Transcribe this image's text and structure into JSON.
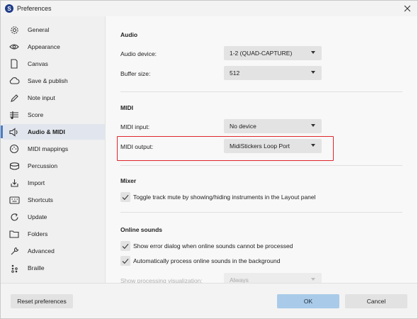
{
  "window": {
    "title": "Preferences",
    "app_icon_letter": "S"
  },
  "sidebar": {
    "items": [
      {
        "label": "General",
        "icon": "gear-icon"
      },
      {
        "label": "Appearance",
        "icon": "eye-icon"
      },
      {
        "label": "Canvas",
        "icon": "page-icon"
      },
      {
        "label": "Save & publish",
        "icon": "cloud-icon"
      },
      {
        "label": "Note input",
        "icon": "pen-icon"
      },
      {
        "label": "Score",
        "icon": "score-icon"
      },
      {
        "label": "Audio & MIDI",
        "icon": "speaker-icon",
        "active": true
      },
      {
        "label": "MIDI mappings",
        "icon": "midi-port-icon"
      },
      {
        "label": "Percussion",
        "icon": "drum-icon"
      },
      {
        "label": "Import",
        "icon": "import-icon"
      },
      {
        "label": "Shortcuts",
        "icon": "keyboard-icon"
      },
      {
        "label": "Update",
        "icon": "refresh-icon"
      },
      {
        "label": "Folders",
        "icon": "folder-icon"
      },
      {
        "label": "Advanced",
        "icon": "wrench-icon"
      },
      {
        "label": "Braille",
        "icon": "braille-icon"
      }
    ]
  },
  "audio": {
    "title": "Audio",
    "device_label": "Audio device:",
    "device_value": "1-2 (QUAD-CAPTURE)",
    "buffer_label": "Buffer size:",
    "buffer_value": "512"
  },
  "midi": {
    "title": "MIDI",
    "input_label": "MIDI input:",
    "input_value": "No device",
    "output_label": "MIDI output:",
    "output_value": "MidiStickers Loop Port"
  },
  "mixer": {
    "title": "Mixer",
    "toggle_mute_label": "Toggle track mute by showing/hiding instruments in the Layout panel",
    "toggle_mute_checked": true
  },
  "online_sounds": {
    "title": "Online sounds",
    "show_error_label": "Show error dialog when online sounds cannot be processed",
    "show_error_checked": true,
    "auto_process_label": "Automatically process online sounds in the background",
    "auto_process_checked": true,
    "visualization_label": "Show processing visualization:",
    "visualization_value": "Always"
  },
  "footer": {
    "reset_label": "Reset preferences",
    "ok_label": "OK",
    "cancel_label": "Cancel"
  },
  "colors": {
    "accent": "#4a7dc4",
    "primary_button": "#a9cbe9",
    "highlight_box": "#e0262b"
  }
}
